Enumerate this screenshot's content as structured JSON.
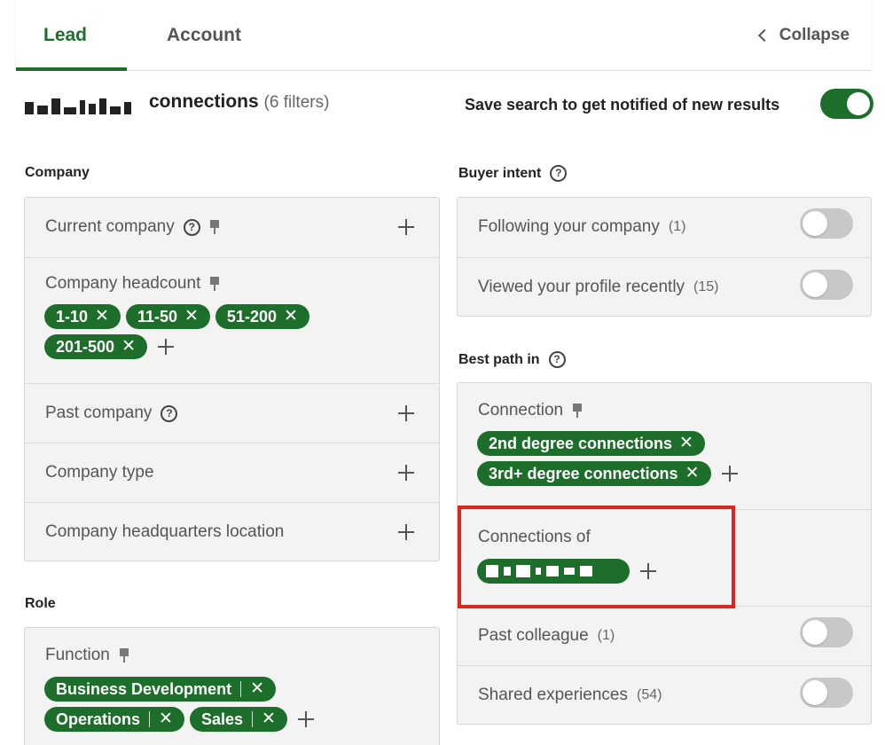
{
  "tabs": {
    "lead": "Lead",
    "account": "Account",
    "collapse": "Collapse"
  },
  "header": {
    "title": "connections",
    "filters": "(6 filters)",
    "save_search": "Save search to get notified of new results"
  },
  "company": {
    "label": "Company",
    "current_company": "Current company",
    "headcount": "Company headcount",
    "headcount_chips": [
      "1-10",
      "11-50",
      "51-200",
      "201-500"
    ],
    "past_company": "Past company",
    "company_type": "Company type",
    "hq_location": "Company headquarters location"
  },
  "role": {
    "label": "Role",
    "function": "Function",
    "function_chips": [
      "Business Development",
      "Operations",
      "Sales"
    ]
  },
  "buyer_intent": {
    "label": "Buyer intent",
    "following": "Following your company",
    "following_count": "(1)",
    "viewed": "Viewed your profile recently",
    "viewed_count": "(15)"
  },
  "best_path": {
    "label": "Best path in",
    "connection": "Connection",
    "connection_chips": [
      "2nd degree connections",
      "3rd+ degree connections"
    ],
    "connections_of": "Connections of",
    "past_colleague": "Past colleague",
    "past_colleague_count": "(1)",
    "shared": "Shared experiences",
    "shared_count": "(54)"
  },
  "chip_close_glyph": "✕",
  "colors": {
    "accent": "#1d6e2a",
    "highlight": "#d72a1f"
  }
}
